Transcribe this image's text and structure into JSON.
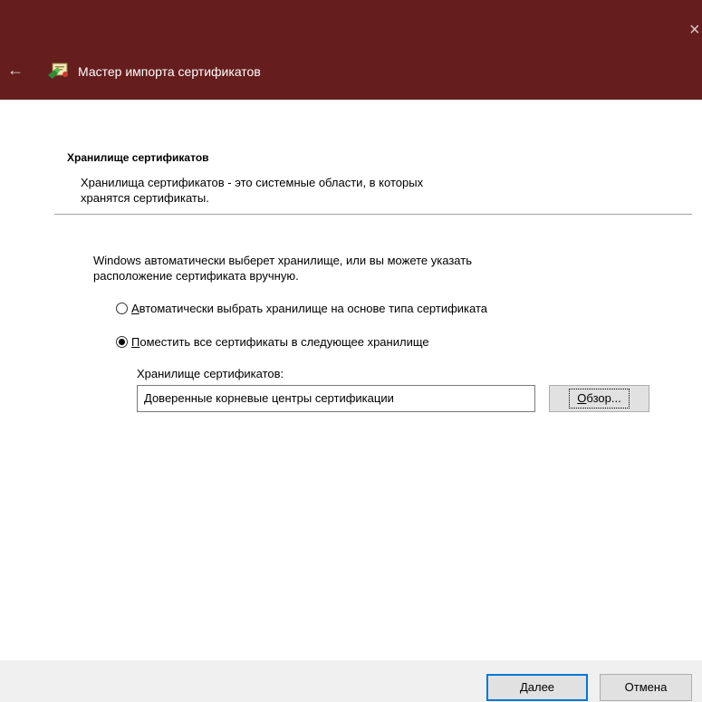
{
  "window": {
    "title": "Мастер импорта сертификатов",
    "close_glyph": "×",
    "back_glyph": "←",
    "title_bar_color": "#651d1d",
    "icons": [
      "close-icon",
      "back-arrow-icon",
      "certificate-wizard-icon"
    ]
  },
  "header": {
    "title": "Хранилище сертификатов",
    "description_line1": "Хранилища сертификатов - это системные области, в которых",
    "description_line2": "хранятся сертификаты."
  },
  "body": {
    "intro_line1": "Windows автоматически выберет хранилище, или вы можете указать",
    "intro_line2": "расположение сертификата вручную.",
    "options": [
      {
        "accel": "А",
        "rest": "втоматически выбрать хранилище на основе типа сертификата",
        "checked": false
      },
      {
        "accel": "П",
        "rest": "оместить все сертификаты в следующее хранилище",
        "checked": true
      }
    ],
    "store_label": "Хранилище сертификатов:",
    "store_value": "Доверенные корневые центры сертификации",
    "browse_accel": "О",
    "browse_rest": "бзор..."
  },
  "footer": {
    "next_accel": "Д",
    "next_rest": "алее",
    "cancel_label": "Отмена",
    "accent_color": "#0078d7"
  }
}
